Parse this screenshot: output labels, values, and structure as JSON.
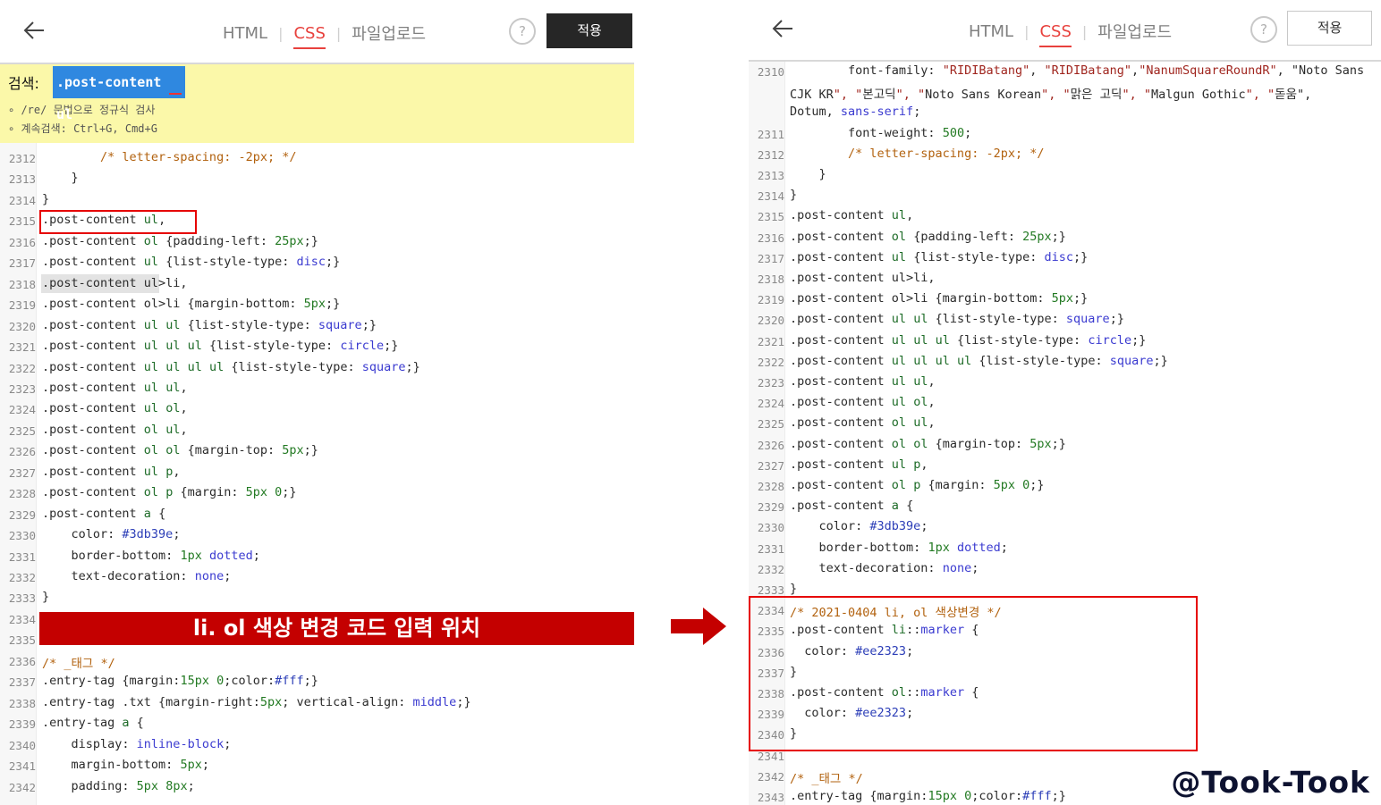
{
  "left": {
    "tabs": [
      "HTML",
      "CSS",
      "파일업로드"
    ],
    "help": "?",
    "apply": "적용",
    "search_label": "검색:",
    "search_query": ".post-content ul",
    "hints": [
      "/re/ 문법으로 정규식 검사",
      "계속검색: Ctrl+G, Cmd+G"
    ],
    "banner": "li. ol 색상 변경 코드 입력 위치",
    "lines": [
      {
        "n": "2312",
        "t": "        /* letter-spacing: -2px; */"
      },
      {
        "n": "2313",
        "t": "    }"
      },
      {
        "n": "2314",
        "t": "}"
      },
      {
        "n": "2315",
        "t": ".post-content ul,"
      },
      {
        "n": "2316",
        "t": ".post-content ol {padding-left: 25px;}"
      },
      {
        "n": "2317",
        "t": ".post-content ul {list-style-type: disc;}"
      },
      {
        "n": "2318",
        "t": ".post-content ul>li,"
      },
      {
        "n": "2319",
        "t": ".post-content ol>li {margin-bottom: 5px;}"
      },
      {
        "n": "2320",
        "t": ".post-content ul ul {list-style-type: square;}"
      },
      {
        "n": "2321",
        "t": ".post-content ul ul ul {list-style-type: circle;}"
      },
      {
        "n": "2322",
        "t": ".post-content ul ul ul ul {list-style-type: square;}"
      },
      {
        "n": "2323",
        "t": ".post-content ul ul,"
      },
      {
        "n": "2324",
        "t": ".post-content ul ol,"
      },
      {
        "n": "2325",
        "t": ".post-content ol ul,"
      },
      {
        "n": "2326",
        "t": ".post-content ol ol {margin-top: 5px;}"
      },
      {
        "n": "2327",
        "t": ".post-content ul p,"
      },
      {
        "n": "2328",
        "t": ".post-content ol p {margin: 5px 0;}"
      },
      {
        "n": "2329",
        "t": ".post-content a {"
      },
      {
        "n": "2330",
        "t": "    color: #3db39e;"
      },
      {
        "n": "2331",
        "t": "    border-bottom: 1px dotted;"
      },
      {
        "n": "2332",
        "t": "    text-decoration: none;"
      },
      {
        "n": "2333",
        "t": "}"
      },
      {
        "n": "2334",
        "t": ""
      },
      {
        "n": "2335",
        "t": ""
      },
      {
        "n": "2336",
        "t": "/* _태그 */"
      },
      {
        "n": "2337",
        "t": ".entry-tag {margin:15px 0;color:#fff;}"
      },
      {
        "n": "2338",
        "t": ".entry-tag .txt {margin-right:5px; vertical-align: middle;}"
      },
      {
        "n": "2339",
        "t": ".entry-tag a {"
      },
      {
        "n": "2340",
        "t": "    display: inline-block;"
      },
      {
        "n": "2341",
        "t": "    margin-bottom: 5px;"
      },
      {
        "n": "2342",
        "t": "    padding: 5px 8px;"
      }
    ]
  },
  "right": {
    "tabs": [
      "HTML",
      "CSS",
      "파일업로드"
    ],
    "help": "?",
    "apply": "적용",
    "lines": [
      {
        "n": "2310",
        "t": "        font-family: \"RIDIBatang\", \"RIDIBatang\",\"NanumSquareRoundR\", \"Noto Sans"
      },
      {
        "n": "",
        "t": "CJK KR\", \"본고딕\", \"Noto Sans Korean\", \"맑은 고딕\", \"Malgun Gothic\", \"돋움\","
      },
      {
        "n": "",
        "t": "Dotum, sans-serif;"
      },
      {
        "n": "2311",
        "t": "        font-weight: 500;"
      },
      {
        "n": "2312",
        "t": "        /* letter-spacing: -2px; */"
      },
      {
        "n": "2313",
        "t": "    }"
      },
      {
        "n": "2314",
        "t": "}"
      },
      {
        "n": "2315",
        "t": ".post-content ul,"
      },
      {
        "n": "2316",
        "t": ".post-content ol {padding-left: 25px;}"
      },
      {
        "n": "2317",
        "t": ".post-content ul {list-style-type: disc;}"
      },
      {
        "n": "2318",
        "t": ".post-content ul>li,"
      },
      {
        "n": "2319",
        "t": ".post-content ol>li {margin-bottom: 5px;}"
      },
      {
        "n": "2320",
        "t": ".post-content ul ul {list-style-type: square;}"
      },
      {
        "n": "2321",
        "t": ".post-content ul ul ul {list-style-type: circle;}"
      },
      {
        "n": "2322",
        "t": ".post-content ul ul ul ul {list-style-type: square;}"
      },
      {
        "n": "2323",
        "t": ".post-content ul ul,"
      },
      {
        "n": "2324",
        "t": ".post-content ul ol,"
      },
      {
        "n": "2325",
        "t": ".post-content ol ul,"
      },
      {
        "n": "2326",
        "t": ".post-content ol ol {margin-top: 5px;}"
      },
      {
        "n": "2327",
        "t": ".post-content ul p,"
      },
      {
        "n": "2328",
        "t": ".post-content ol p {margin: 5px 0;}"
      },
      {
        "n": "2329",
        "t": ".post-content a {"
      },
      {
        "n": "2330",
        "t": "    color: #3db39e;"
      },
      {
        "n": "2331",
        "t": "    border-bottom: 1px dotted;"
      },
      {
        "n": "2332",
        "t": "    text-decoration: none;"
      },
      {
        "n": "2333",
        "t": "}"
      },
      {
        "n": "2334",
        "t": "/* 2021-0404 li, ol 색상변경 */"
      },
      {
        "n": "2335",
        "t": ".post-content li::marker {"
      },
      {
        "n": "2336",
        "t": "  color: #ee2323;"
      },
      {
        "n": "2337",
        "t": "}"
      },
      {
        "n": "2338",
        "t": ".post-content ol::marker {"
      },
      {
        "n": "2339",
        "t": "  color: #ee2323;"
      },
      {
        "n": "2340",
        "t": "}"
      },
      {
        "n": "2341",
        "t": ""
      },
      {
        "n": "2342",
        "t": "/* _태그 */"
      },
      {
        "n": "2343",
        "t": ".entry-tag {margin:15px 0;color:#fff;}"
      }
    ]
  },
  "watermark": "@Took-Took",
  "colors": {
    "accent_red": "#e8413d",
    "highlight_red": "#e60000",
    "banner_red": "#c40000",
    "search_yellow": "#fbf8a9",
    "search_blue": "#2f88e0"
  }
}
